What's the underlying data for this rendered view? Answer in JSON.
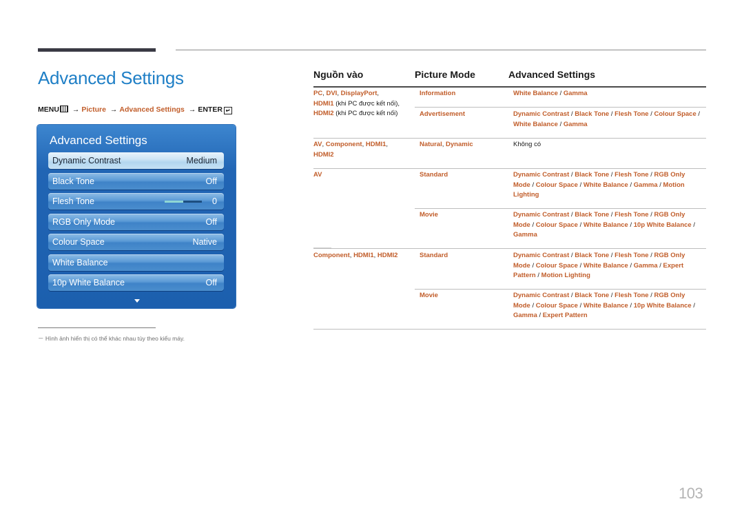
{
  "header": {
    "title": "Advanced Settings"
  },
  "menu_path": {
    "menu": "MENU",
    "picture": "Picture",
    "advanced": "Advanced Settings",
    "enter": "ENTER",
    "arrow": "→",
    "menu_icon": "menu-grid-icon",
    "enter_icon": "enter-return-icon"
  },
  "osd": {
    "title": "Advanced Settings",
    "items": [
      {
        "label": "Dynamic Contrast",
        "value": "Medium",
        "active": true
      },
      {
        "label": "Black Tone",
        "value": "Off"
      },
      {
        "label": "Flesh Tone",
        "value": "0",
        "slider_level": 0.5
      },
      {
        "label": "RGB Only Mode",
        "value": "Off"
      },
      {
        "label": "Colour Space",
        "value": "Native"
      },
      {
        "label": "White Balance",
        "value": ""
      },
      {
        "label": "10p White Balance",
        "value": "Off"
      }
    ],
    "more_icon": "chevron-down-icon"
  },
  "footnote": "－ Hình ảnh hiển thị có thể khác nhau tùy theo kiểu máy.",
  "table": {
    "headers": [
      "Nguồn vào",
      "Picture Mode",
      "Advanced Settings"
    ],
    "rows": [
      {
        "source": [
          [
            "PC",
            "o"
          ],
          [
            ", ",
            ""
          ],
          [
            "DVI",
            "o"
          ],
          [
            ", ",
            ""
          ],
          [
            "DisplayPort",
            "o"
          ],
          [
            ",",
            ""
          ],
          [
            "\n",
            ""
          ],
          [
            "HDMI1",
            "o"
          ],
          [
            " (khi PC được kết nối), ",
            ""
          ],
          [
            "HDMI2",
            "o"
          ],
          [
            " (khi PC được kết nối)",
            ""
          ]
        ],
        "modes": [
          {
            "mode": [
              [
                "Information",
                "o"
              ]
            ],
            "settings": [
              [
                "White Balance",
                "o"
              ],
              [
                " / ",
                ""
              ],
              [
                "Gamma",
                "o"
              ]
            ]
          },
          {
            "mode": [
              [
                "Advertisement",
                "o"
              ]
            ],
            "settings": [
              [
                "Dynamic Contrast",
                "o"
              ],
              [
                " / ",
                ""
              ],
              [
                "Black Tone",
                "o"
              ],
              [
                " / ",
                ""
              ],
              [
                "Flesh Tone",
                "o"
              ],
              [
                " / ",
                ""
              ],
              [
                "Colour Space",
                "o"
              ],
              [
                " / ",
                ""
              ],
              [
                "White Balance",
                "o"
              ],
              [
                " / ",
                ""
              ],
              [
                "Gamma",
                "o"
              ]
            ]
          }
        ]
      },
      {
        "source": [
          [
            "AV",
            "o"
          ],
          [
            ", ",
            ""
          ],
          [
            "Component",
            "o"
          ],
          [
            ", ",
            ""
          ],
          [
            "HDMI1",
            "o"
          ],
          [
            ", ",
            ""
          ],
          [
            "HDMI2",
            "o"
          ]
        ],
        "modes": [
          {
            "mode": [
              [
                "Natural",
                "o"
              ],
              [
                ", ",
                ""
              ],
              [
                "Dynamic",
                "o"
              ]
            ],
            "settings": [
              [
                "Không có",
                ""
              ]
            ]
          }
        ]
      },
      {
        "source": [
          [
            "AV",
            "o"
          ]
        ],
        "modes": [
          {
            "mode": [
              [
                "Standard",
                "o"
              ]
            ],
            "settings": [
              [
                "Dynamic Contrast",
                "o"
              ],
              [
                " / ",
                ""
              ],
              [
                "Black Tone",
                "o"
              ],
              [
                " / ",
                ""
              ],
              [
                "Flesh Tone",
                "o"
              ],
              [
                " / ",
                ""
              ],
              [
                "RGB Only Mode",
                "o"
              ],
              [
                " / ",
                ""
              ],
              [
                "Colour Space",
                "o"
              ],
              [
                " / ",
                ""
              ],
              [
                "White Balance",
                "o"
              ],
              [
                " / ",
                ""
              ],
              [
                "Gamma",
                "o"
              ],
              [
                " / ",
                ""
              ],
              [
                "Motion Lighting",
                "o"
              ]
            ]
          },
          {
            "mode": [
              [
                "Movie",
                "o"
              ]
            ],
            "settings": [
              [
                "Dynamic Contrast",
                "o"
              ],
              [
                " / ",
                ""
              ],
              [
                "Black Tone",
                "o"
              ],
              [
                " / ",
                ""
              ],
              [
                "Flesh Tone",
                "o"
              ],
              [
                " / ",
                ""
              ],
              [
                "RGB Only Mode",
                "o"
              ],
              [
                " / ",
                ""
              ],
              [
                "Colour Space",
                "o"
              ],
              [
                " / ",
                ""
              ],
              [
                "White Balance",
                "o"
              ],
              [
                " / ",
                ""
              ],
              [
                "10p White Balance",
                "o"
              ],
              [
                " / ",
                ""
              ],
              [
                "Gamma",
                "o"
              ]
            ]
          }
        ]
      },
      {
        "source": [
          [
            "Component",
            "o"
          ],
          [
            ", ",
            ""
          ],
          [
            "HDMI1",
            "o"
          ],
          [
            ", ",
            ""
          ],
          [
            "HDMI2",
            "o"
          ]
        ],
        "modes": [
          {
            "mode": [
              [
                "Standard",
                "o"
              ]
            ],
            "settings": [
              [
                "Dynamic Contrast",
                "o"
              ],
              [
                " / ",
                ""
              ],
              [
                "Black Tone",
                "o"
              ],
              [
                " / ",
                ""
              ],
              [
                "Flesh Tone",
                "o"
              ],
              [
                " / ",
                ""
              ],
              [
                "RGB Only Mode",
                "o"
              ],
              [
                " / ",
                ""
              ],
              [
                "Colour Space",
                "o"
              ],
              [
                " / ",
                ""
              ],
              [
                "White Balance",
                "o"
              ],
              [
                " / ",
                ""
              ],
              [
                "Gamma",
                "o"
              ],
              [
                " / ",
                ""
              ],
              [
                "Expert Pattern",
                "o"
              ],
              [
                " / ",
                ""
              ],
              [
                "Motion Lighting",
                "o"
              ]
            ]
          },
          {
            "mode": [
              [
                "Movie",
                "o"
              ]
            ],
            "settings": [
              [
                "Dynamic Contrast",
                "o"
              ],
              [
                " / ",
                ""
              ],
              [
                "Black Tone",
                "o"
              ],
              [
                " / ",
                ""
              ],
              [
                "Flesh Tone",
                "o"
              ],
              [
                " / ",
                ""
              ],
              [
                "RGB Only Mode",
                "o"
              ],
              [
                " / ",
                ""
              ],
              [
                "Colour Space",
                "o"
              ],
              [
                " / ",
                ""
              ],
              [
                "White Balance",
                "o"
              ],
              [
                " / ",
                ""
              ],
              [
                "10p White Balance",
                "o"
              ],
              [
                " / ",
                ""
              ],
              [
                "Gamma",
                "o"
              ],
              [
                " / ",
                ""
              ],
              [
                "Expert Pattern",
                "o"
              ]
            ]
          }
        ]
      }
    ]
  },
  "colors": {
    "title_blue": "#1f7fc6",
    "highlight_orange": "#c15d2a",
    "osd_blue": "#1c5fae"
  },
  "page_number": "103"
}
